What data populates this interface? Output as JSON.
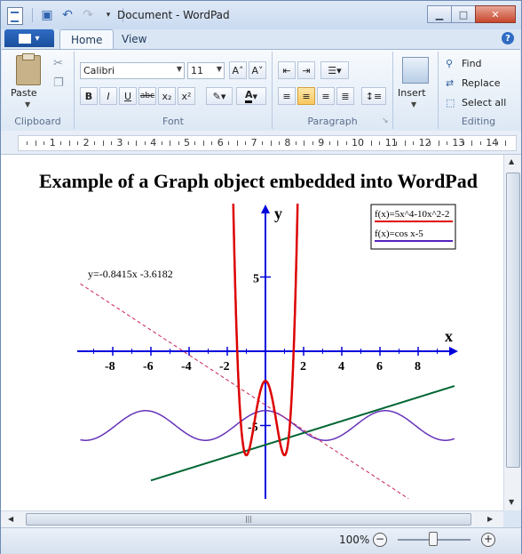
{
  "window": {
    "title": "Document - WordPad"
  },
  "tabs": {
    "file_icon": "wordpad-menu-icon",
    "home": "Home",
    "view": "View"
  },
  "ribbon": {
    "clipboard": {
      "paste": "Paste",
      "label": "Clipboard"
    },
    "font": {
      "family": "Calibri",
      "size": "11",
      "label": "Font",
      "bold": "B",
      "italic": "I",
      "underline": "U",
      "strike": "abc",
      "subscript": "x₂",
      "superscript": "x²",
      "grow": "A˄",
      "shrink": "A˅"
    },
    "paragraph": {
      "label": "Paragraph"
    },
    "insert": {
      "label": "Insert"
    },
    "editing": {
      "label": "Editing",
      "find": "Find",
      "replace": "Replace",
      "select_all": "Select all"
    }
  },
  "ruler": {
    "numbers": [
      "1",
      "2",
      "3",
      "4",
      "5",
      "6",
      "7",
      "8",
      "9",
      "10",
      "11",
      "12",
      "13",
      "14"
    ]
  },
  "document": {
    "title": "Example of a Graph object embedded into WordPad",
    "graph": {
      "x_axis_label": "x",
      "y_axis_label": "y",
      "x_ticks": [
        "-8",
        "-6",
        "-4",
        "-2",
        "2",
        "4",
        "6",
        "8"
      ],
      "y_ticks": [
        "5",
        "-5"
      ],
      "legend": [
        {
          "label": "f(x)=5x^4-10x^2-2",
          "color": "#dd0000"
        },
        {
          "label": "f(x)=cos x-5",
          "color": "#5522bb"
        }
      ],
      "regression_label": "y=-0.8415x -3.6182",
      "colors": {
        "axes": "#0000dd",
        "poly": "#dd0000",
        "cos": "#6633bb",
        "green": "#006633",
        "dashed": "#cc2255"
      }
    }
  },
  "status": {
    "zoom": "100%",
    "zoom_out": "−",
    "zoom_in": "+"
  }
}
